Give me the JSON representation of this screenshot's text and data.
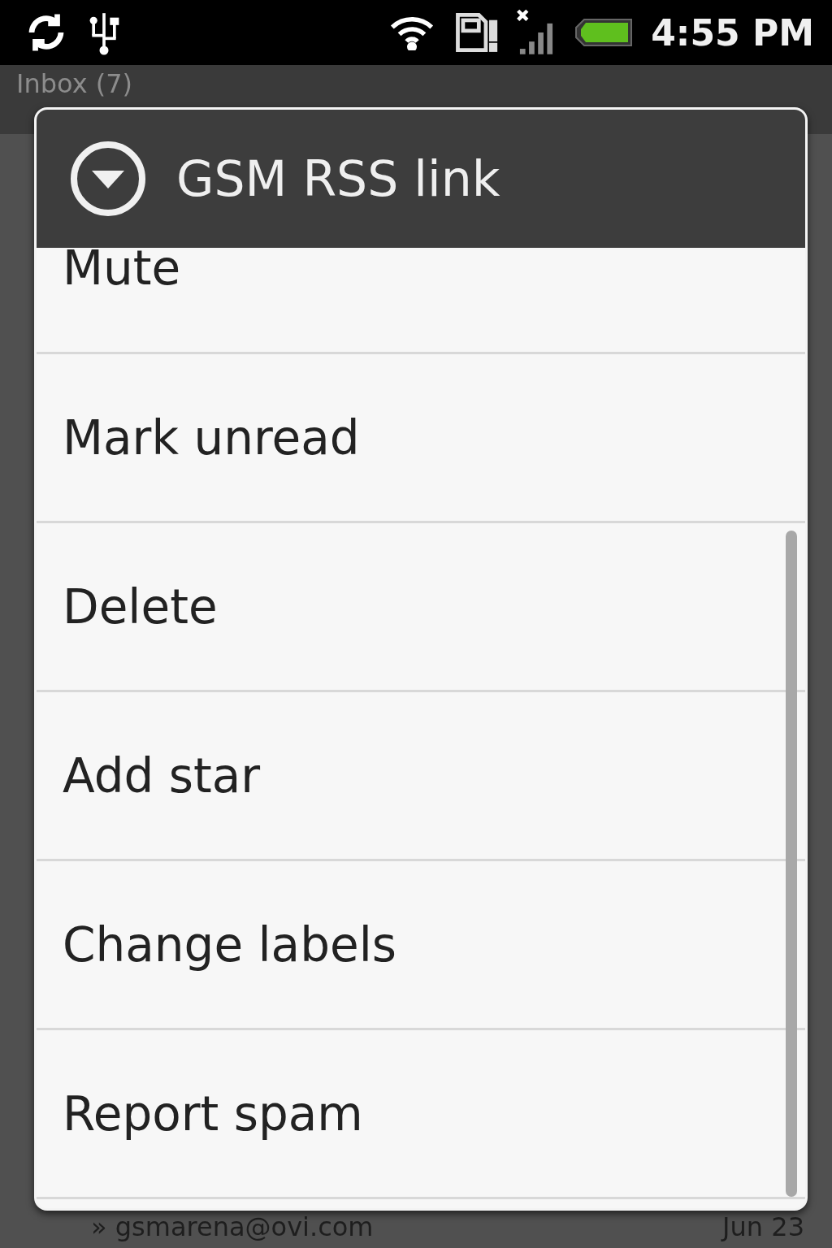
{
  "status_bar": {
    "time": "4:55 PM"
  },
  "background": {
    "title": "Inbox (7)",
    "sender": "» gsmarena@ovi.com",
    "date": "Jun 23"
  },
  "dialog": {
    "title": "GSM RSS link",
    "items": [
      {
        "label": "Mute",
        "cut": true
      },
      {
        "label": "Mark unread",
        "cut": false
      },
      {
        "label": "Delete",
        "cut": false
      },
      {
        "label": "Add star",
        "cut": false
      },
      {
        "label": "Change labels",
        "cut": false
      },
      {
        "label": "Report spam",
        "cut": false
      }
    ]
  }
}
